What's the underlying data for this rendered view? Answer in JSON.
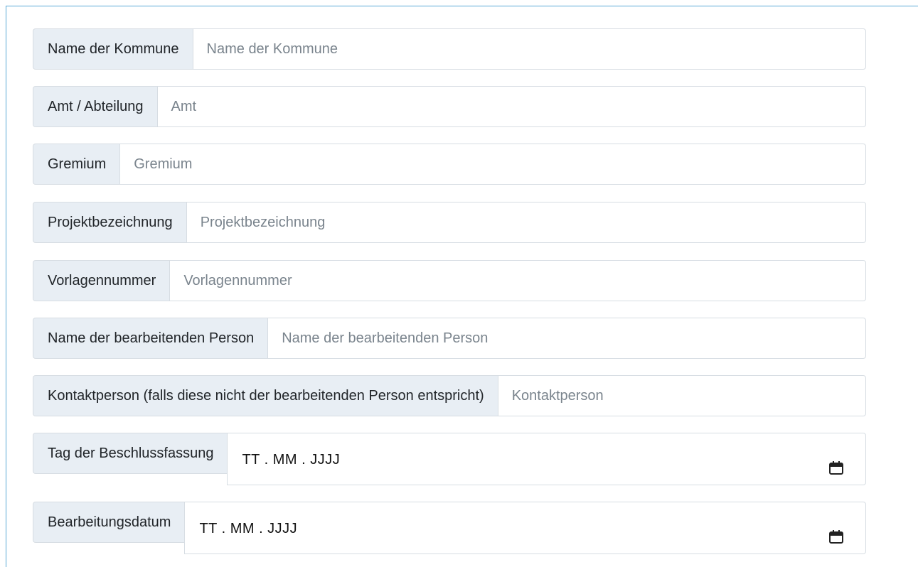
{
  "form": {
    "fields": [
      {
        "label": "Name der Kommune",
        "placeholder": "Name der Kommune"
      },
      {
        "label": "Amt / Abteilung",
        "placeholder": "Amt"
      },
      {
        "label": "Gremium",
        "placeholder": "Gremium"
      },
      {
        "label": "Projektbezeichnung",
        "placeholder": "Projektbezeichnung"
      },
      {
        "label": "Vorlagennummer",
        "placeholder": "Vorlagennummer"
      },
      {
        "label": "Name der bearbeitenden Person",
        "placeholder": "Name der bearbeitenden Person"
      },
      {
        "label": "Kontaktperson (falls diese nicht der bearbeitenden Person entspricht)",
        "placeholder": "Kontaktperson"
      },
      {
        "label": "Tag der Beschlussfassung",
        "placeholder": "TT . MM . JJJJ",
        "icon": "calendar-icon"
      },
      {
        "label": "Bearbeitungsdatum",
        "placeholder": "TT . MM . JJJJ",
        "icon": "calendar-icon"
      }
    ]
  },
  "colors": {
    "label_bg": "#e8eef4",
    "border": "#d7dde3",
    "frame": "#5aa9d6",
    "placeholder": "#7a848d"
  }
}
